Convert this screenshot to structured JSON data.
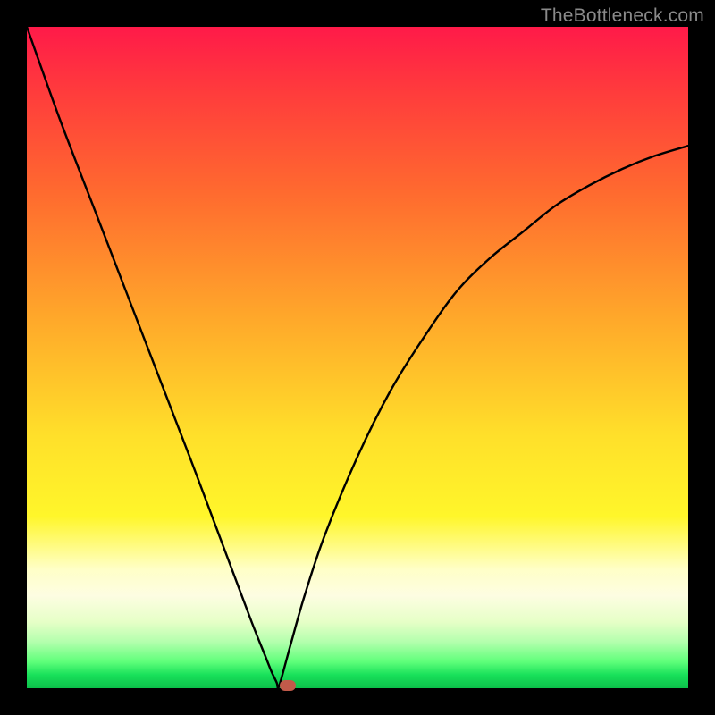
{
  "watermark": "TheBottleneck.com",
  "colors": {
    "frame_bg": "#000000",
    "gradient_top": "#ff1a49",
    "gradient_bottom": "#0cc04a",
    "curve": "#000000",
    "marker": "#c15a4a",
    "watermark_text": "#8a8a8a"
  },
  "chart_data": {
    "type": "line",
    "title": "",
    "xlabel": "",
    "ylabel": "",
    "xlim": [
      0,
      100
    ],
    "ylim": [
      0,
      100
    ],
    "legend": false,
    "grid": false,
    "annotations": [],
    "gradient_meaning": "Vertical red-to-green gradient encodes the output value; red (top) = high bottleneck, green (bottom) = low bottleneck",
    "minimum": {
      "x": 38,
      "y": 0
    },
    "marker": {
      "x": 39.5,
      "y": 0
    },
    "series": [
      {
        "name": "bottleneck-curve",
        "x": [
          0,
          5,
          10,
          15,
          20,
          25,
          28,
          31,
          34,
          36,
          37,
          37.8,
          38,
          38.5,
          40,
          42,
          45,
          50,
          55,
          60,
          65,
          70,
          75,
          80,
          85,
          90,
          95,
          100
        ],
        "values": [
          100,
          86,
          73,
          60,
          47,
          34,
          26,
          18,
          10,
          5,
          2.5,
          0.8,
          0,
          1.5,
          7,
          14,
          23,
          35,
          45,
          53,
          60,
          65,
          69,
          73,
          76,
          78.5,
          80.5,
          82
        ]
      }
    ]
  }
}
